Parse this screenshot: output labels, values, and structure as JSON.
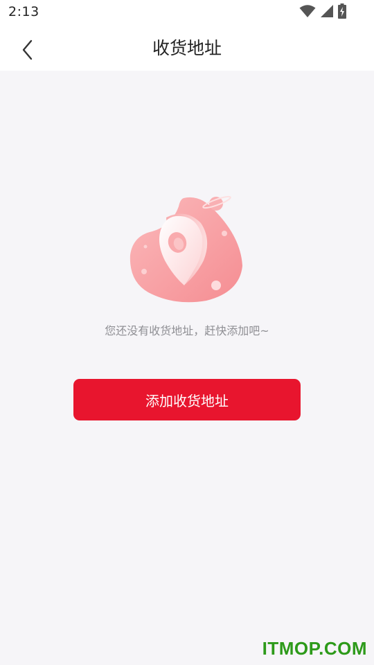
{
  "status_bar": {
    "time": "2:13",
    "icons": [
      "wifi-icon",
      "signal-icon",
      "battery-charging-icon"
    ]
  },
  "nav": {
    "back_icon": "chevron-left-icon",
    "title": "收货地址"
  },
  "empty_state": {
    "illustration": "location-pin-illustration",
    "message": "您还没有收货地址，赶快添加吧~"
  },
  "actions": {
    "add_address_label": "添加收货地址"
  },
  "watermark": {
    "text": "ITMOP.COM"
  },
  "colors": {
    "primary": "#e8152e",
    "background": "#f6f5f8",
    "illustration": "#f7a3a6",
    "watermark": "#2d9a1a"
  }
}
